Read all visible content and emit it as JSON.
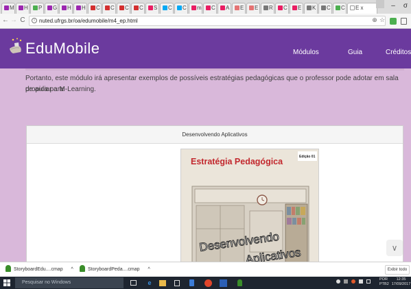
{
  "browser": {
    "tabs": [
      {
        "label": "ME",
        "fav": "#9c27b0",
        "active": false
      },
      {
        "label": "H C",
        "fav": "#9c27b0",
        "active": false
      },
      {
        "label": "P",
        "fav": "#4caf50",
        "active": false
      },
      {
        "label": "G C",
        "fav": "#9c27b0",
        "active": false
      },
      {
        "label": "H F",
        "fav": "#9c27b0",
        "active": false
      },
      {
        "label": "H F",
        "fav": "#9c27b0",
        "active": false
      },
      {
        "label": "C F",
        "fav": "#d32f2f",
        "active": false
      },
      {
        "label": "C F",
        "fav": "#d32f2f",
        "active": false
      },
      {
        "label": "C F",
        "fav": "#d32f2f",
        "active": false
      },
      {
        "label": "C F",
        "fav": "#d32f2f",
        "active": false
      },
      {
        "label": "S",
        "fav": "#e91e63",
        "active": false
      },
      {
        "label": "C",
        "fav": "#03a9f4",
        "active": false
      },
      {
        "label": "C",
        "fav": "#03a9f4",
        "active": false
      },
      {
        "label": "m",
        "fav": "#e91e63",
        "active": false
      },
      {
        "label": "C",
        "fav": "#e91e63",
        "active": false
      },
      {
        "label": "A",
        "fav": "#e91e63",
        "active": false
      },
      {
        "label": "E",
        "fav": "#e57373",
        "active": false
      },
      {
        "label": "E",
        "fav": "#e57373",
        "active": false
      },
      {
        "label": "R",
        "fav": "#777777",
        "active": false
      },
      {
        "label": "C",
        "fav": "#e91e63",
        "active": false
      },
      {
        "label": "E",
        "fav": "#e91e63",
        "active": false
      },
      {
        "label": "K",
        "fav": "#777777",
        "active": false
      },
      {
        "label": "C",
        "fav": "#777777",
        "active": false
      },
      {
        "label": "C",
        "fav": "#4caf50",
        "active": false
      },
      {
        "label": "E x",
        "fav": "#ffffff",
        "active": true
      }
    ],
    "url": "nuted.ufrgs.br/oa/edumobile/m4_ep.html",
    "info_icon": "i",
    "back_icon": "←",
    "forward_icon": "→",
    "reload_icon": "C",
    "zoom_icon": "⊕",
    "star_icon": "☆",
    "minimize_icon": "–",
    "restore_icon": "▢",
    "close_icon": "σ"
  },
  "site": {
    "brand": "EduMobile",
    "nav": [
      "Módulos",
      "Guia",
      "Créditos"
    ],
    "accent": "#6b3a9e",
    "bg": "#d9b8da"
  },
  "content": {
    "para_line1": "Portanto, este módulo irá apresentar exemplos de possíveis estratégias pedagógicas que o professor pode adotar em sala de aula para",
    "para_line2": "propiciar a M-Learning.",
    "panel_title": "Desenvolvendo Aplicativos",
    "cover_title": "Estratégia Pedagógica",
    "cover_edition": "Edição 01",
    "cover_word1": "Desenvolvendo",
    "cover_word2": "Aplicativos",
    "scroll_icon": "∨"
  },
  "downloads": {
    "items": [
      "StoryboardEdu....cmap",
      "StoryboardPeda....cmap"
    ],
    "caret": "^",
    "show_all": "Exibir todo"
  },
  "taskbar": {
    "search_placeholder": "Pesquisar no Windows",
    "lang": "POR",
    "lang2": "PTB2",
    "time": "12:35",
    "date": "17/09/2017"
  }
}
